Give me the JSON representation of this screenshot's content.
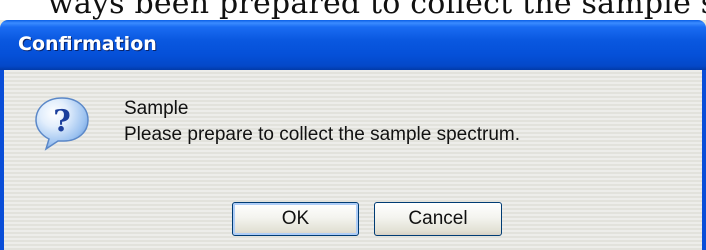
{
  "caption": {
    "text": "ways been prepared to collect the sample spectrum."
  },
  "window": {
    "title": "Confirmation"
  },
  "dialog": {
    "icon": "question-icon",
    "heading": "Sample",
    "message": "Please prepare to collect the sample spectrum."
  },
  "buttons": {
    "ok_label": "OK",
    "cancel_label": "Cancel"
  },
  "colors": {
    "titlebar_accent": "#0a5ee6",
    "client_background": "#ece9d8",
    "button_border": "#003c74"
  }
}
